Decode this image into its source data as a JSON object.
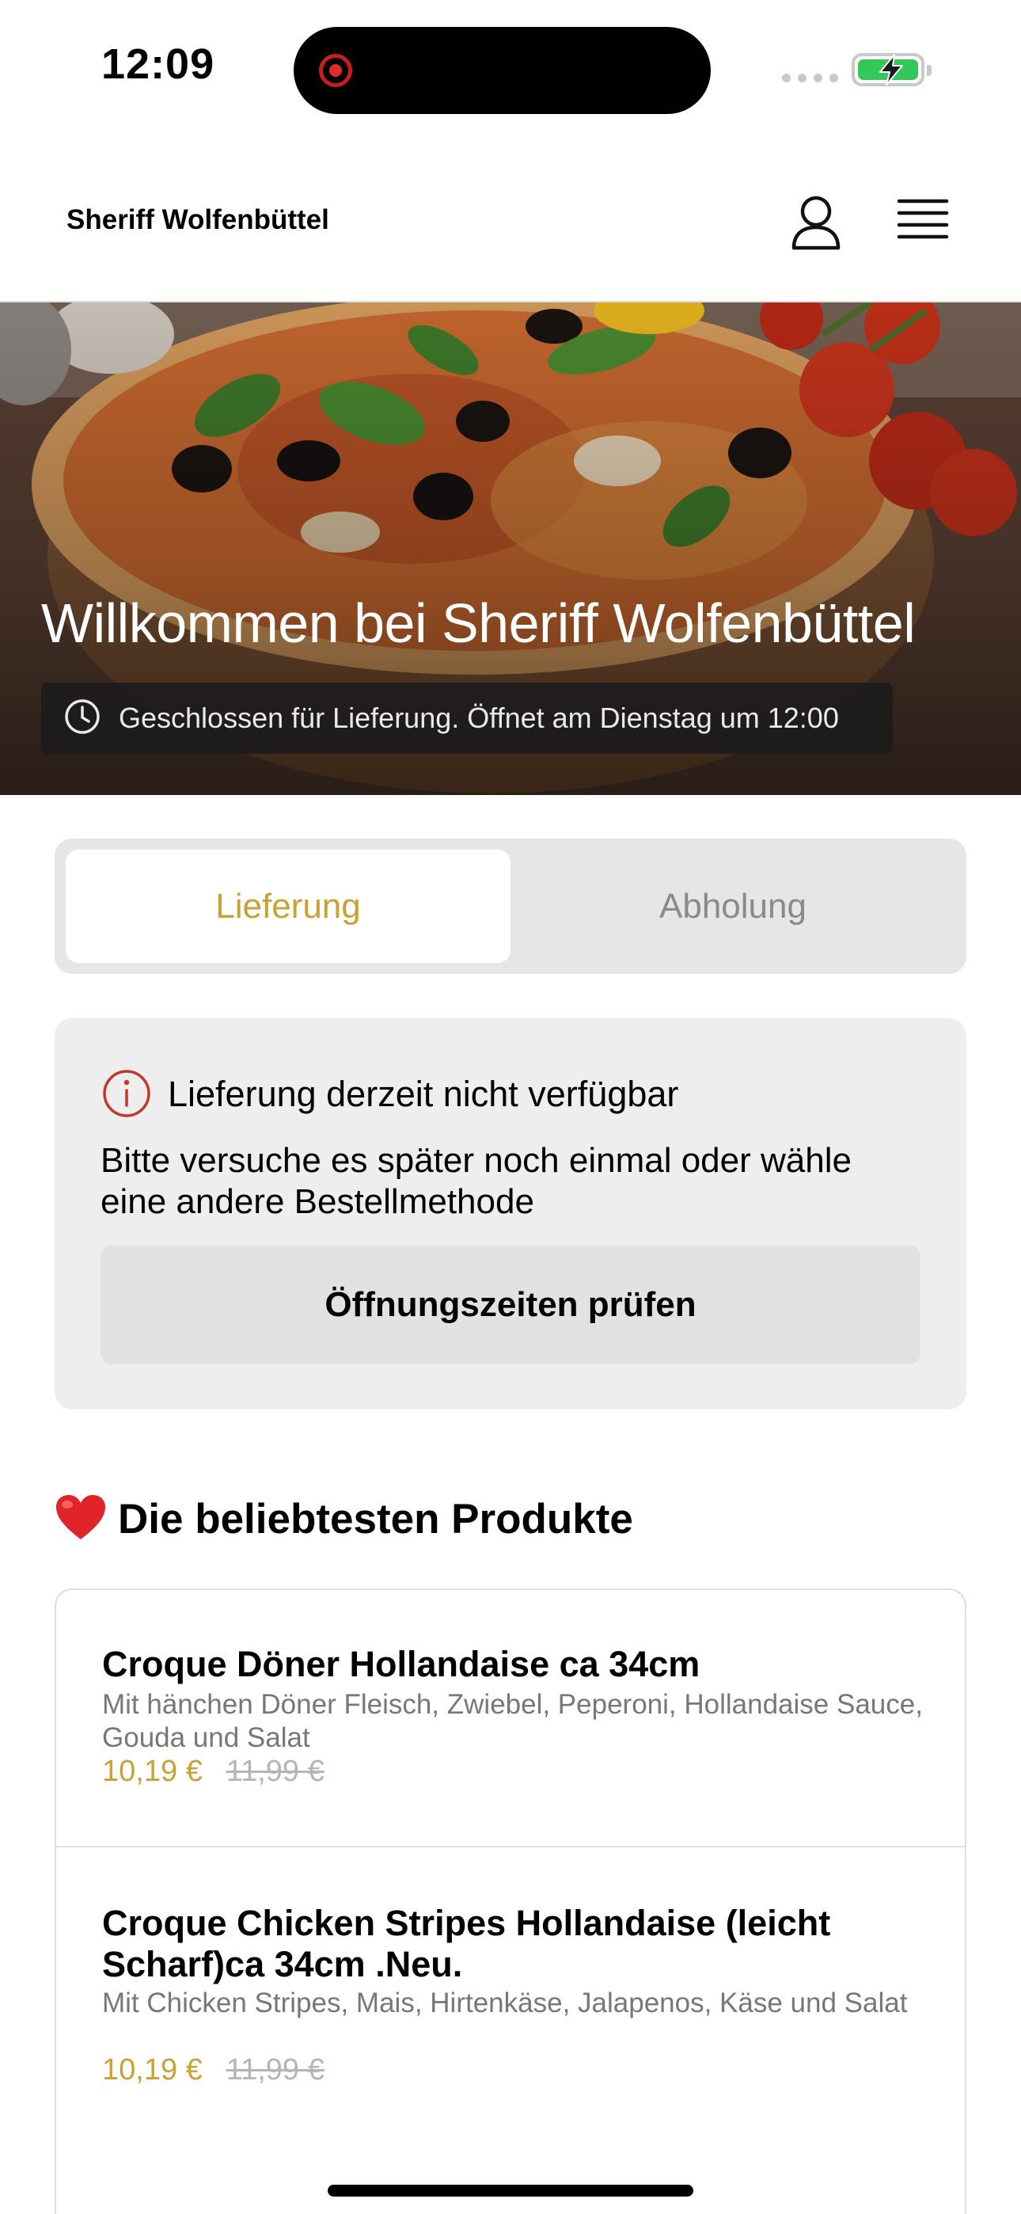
{
  "status_bar": {
    "time": "12:09"
  },
  "header": {
    "brand": "Sheriff Wolfenbüttel"
  },
  "hero": {
    "title": "Willkommen bei Sheriff Wolfenbüttel",
    "notice": "Geschlossen für Lieferung. Öffnet am Dienstag um 12:00"
  },
  "order_mode": {
    "tabs": [
      {
        "label": "Lieferung",
        "active": true
      },
      {
        "label": "Abholung",
        "active": false
      }
    ]
  },
  "unavailable_card": {
    "title": "Lieferung derzeit nicht verfügbar",
    "body": "Bitte versuche es später noch einmal oder wähle eine andere Bestellmethode",
    "button": "Öffnungszeiten prüfen"
  },
  "popular": {
    "emoji": "❤️",
    "title": "Die beliebtesten Produkte",
    "items": [
      {
        "name": "Croque Döner Hollandaise ca 34cm",
        "description": "Mit hänchen Döner Fleisch, Zwiebel, Peperoni, Hollandaise Sauce, Gouda und Salat",
        "price": "10,19 €",
        "old_price": "11,99 €"
      },
      {
        "name": "Croque Chicken Stripes Hollandaise (leicht Scharf)ca 34cm .Neu.",
        "description": "Mit Chicken Stripes, Mais, Hirtenkäse, Jalapenos, Käse und Salat",
        "price": "10,19 €",
        "old_price": "11,99 €"
      }
    ]
  },
  "colors": {
    "accent": "#c9a233",
    "battery": "#34c759",
    "recording": "#e22a2a",
    "card_background": "#eeeeee"
  },
  "icons": [
    "user-icon",
    "hamburger-menu-icon",
    "clock-icon",
    "info-icon",
    "heart-emoji",
    "battery-charging-icon"
  ]
}
